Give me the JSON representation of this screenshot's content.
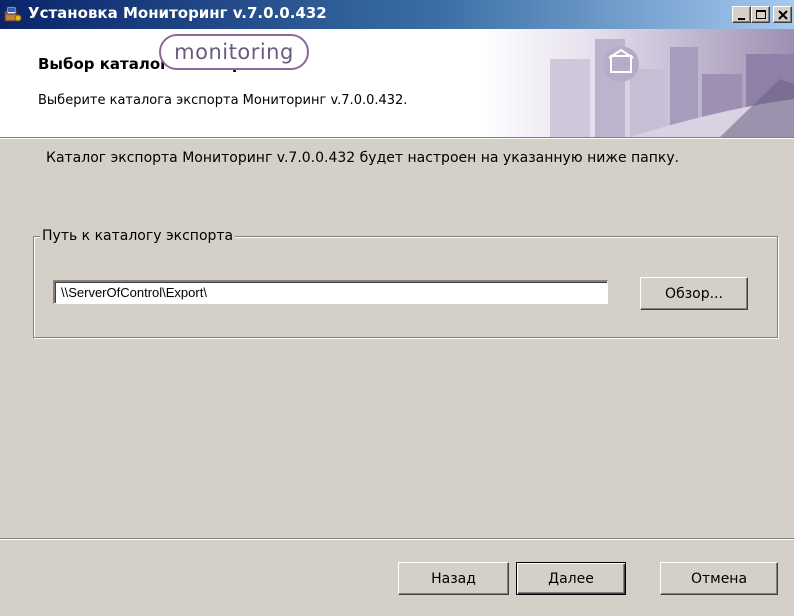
{
  "window": {
    "title": "Установка Мониторинг v.7.0.0.432",
    "icon": "installer-icon",
    "controls": [
      "minimize-icon",
      "maximize-icon",
      "close-icon"
    ]
  },
  "banner": {
    "title": "Выбор каталога экспорта.",
    "subtitle": "Выберите каталога экспорта Мониторинг v.7.0.0.432.",
    "logo_text": "monitoring"
  },
  "main": {
    "description": "Каталог экспорта Мониторинг v.7.0.0.432 будет настроен на указанную ниже папку.",
    "group_label": "Путь к каталогу экспорта",
    "path_value": "\\\\ServerOfControl\\Export\\",
    "browse_label": "Обзор..."
  },
  "footer": {
    "back_label": "Назад",
    "next_label": "Далее",
    "cancel_label": "Отмена"
  },
  "colors": {
    "titlebar_start": "#0a246a",
    "titlebar_end": "#a6caf0",
    "dialog_bg": "#d4d0c8",
    "logo_border": "#8a6a9a"
  }
}
